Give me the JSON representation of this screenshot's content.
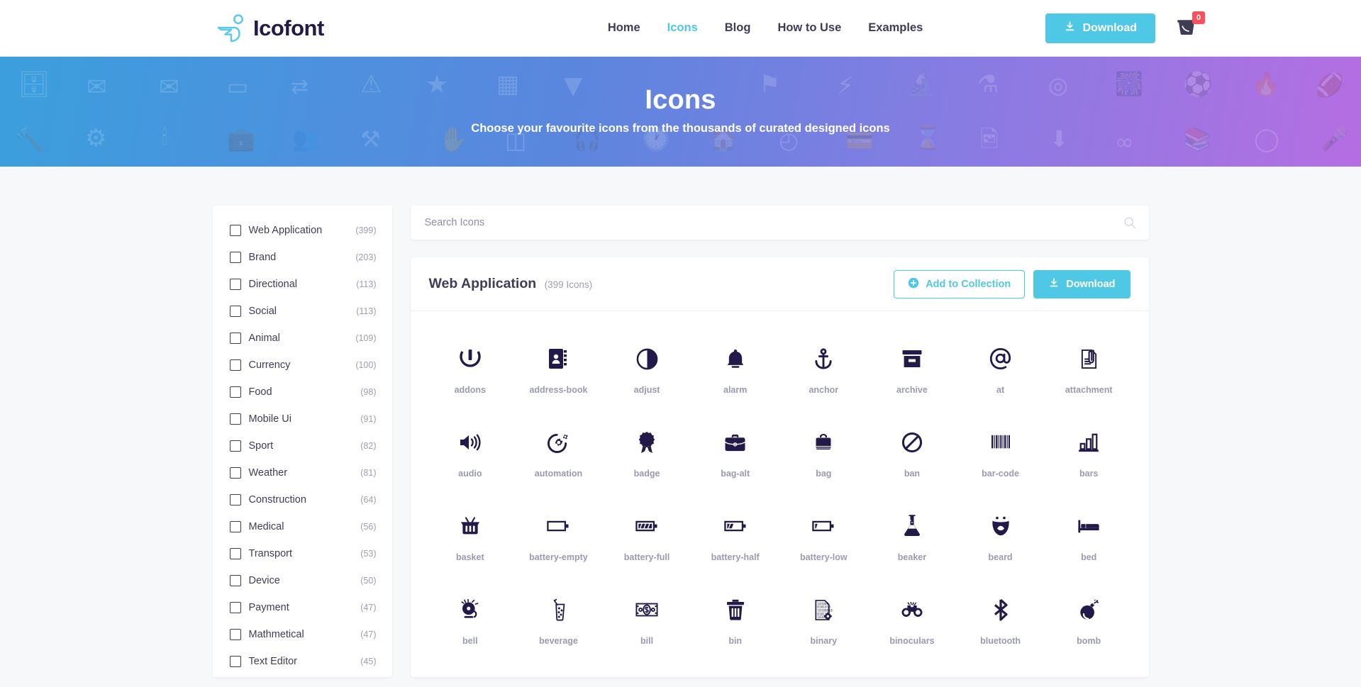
{
  "header": {
    "brand": "Icofont",
    "brand_logo_icon": "bird-leaf-logo-icon",
    "nav": [
      {
        "label": "Home",
        "active": false
      },
      {
        "label": "Icons",
        "active": true
      },
      {
        "label": "Blog",
        "active": false
      },
      {
        "label": "How to Use",
        "active": false
      },
      {
        "label": "Examples",
        "active": false
      }
    ],
    "download_label": "Download",
    "download_icon": "download-icon",
    "cart_icon": "cart-bucket-icon",
    "cart_count": "0",
    "accent_color": "#4ec8e4",
    "badge_color": "#fc4f5e",
    "text_color": "#3f3d56"
  },
  "hero": {
    "title": "Icons",
    "subtitle": "Choose your favourite icons from the thousands of curated designed icons",
    "gradient_from": "#3b9fdd",
    "gradient_to": "#b56ee2"
  },
  "sidebar": {
    "categories": [
      {
        "label": "Web Application",
        "count": "(399)"
      },
      {
        "label": "Brand",
        "count": "(203)"
      },
      {
        "label": "Directional",
        "count": "(113)"
      },
      {
        "label": "Social",
        "count": "(113)"
      },
      {
        "label": "Animal",
        "count": "(109)"
      },
      {
        "label": "Currency",
        "count": "(100)"
      },
      {
        "label": "Food",
        "count": "(98)"
      },
      {
        "label": "Mobile Ui",
        "count": "(91)"
      },
      {
        "label": "Sport",
        "count": "(82)"
      },
      {
        "label": "Weather",
        "count": "(81)"
      },
      {
        "label": "Construction",
        "count": "(64)"
      },
      {
        "label": "Medical",
        "count": "(56)"
      },
      {
        "label": "Transport",
        "count": "(53)"
      },
      {
        "label": "Device",
        "count": "(50)"
      },
      {
        "label": "Payment",
        "count": "(47)"
      },
      {
        "label": "Mathmetical",
        "count": "(47)"
      },
      {
        "label": "Text Editor",
        "count": "(45)"
      }
    ]
  },
  "search": {
    "placeholder": "Search Icons",
    "value": "",
    "icon": "search-icon"
  },
  "panel": {
    "title": "Web Application",
    "count": "(399 Icons)",
    "add_to_collection_label": "Add to Collection",
    "add_to_collection_icon": "plus-circle-icon",
    "download_label": "Download",
    "download_icon": "download-icon"
  },
  "icons": [
    {
      "name": "addons",
      "glyph": "addons-icon"
    },
    {
      "name": "address-book",
      "glyph": "address-book-icon"
    },
    {
      "name": "adjust",
      "glyph": "adjust-icon"
    },
    {
      "name": "alarm",
      "glyph": "alarm-icon"
    },
    {
      "name": "anchor",
      "glyph": "anchor-icon"
    },
    {
      "name": "archive",
      "glyph": "archive-icon"
    },
    {
      "name": "at",
      "glyph": "at-icon"
    },
    {
      "name": "attachment",
      "glyph": "attachment-icon"
    },
    {
      "name": "audio",
      "glyph": "audio-icon"
    },
    {
      "name": "automation",
      "glyph": "automation-icon"
    },
    {
      "name": "badge",
      "glyph": "badge-icon"
    },
    {
      "name": "bag-alt",
      "glyph": "bag-alt-icon"
    },
    {
      "name": "bag",
      "glyph": "bag-icon"
    },
    {
      "name": "ban",
      "glyph": "ban-icon"
    },
    {
      "name": "bar-code",
      "glyph": "bar-code-icon"
    },
    {
      "name": "bars",
      "glyph": "bars-icon"
    },
    {
      "name": "basket",
      "glyph": "basket-icon"
    },
    {
      "name": "battery-empty",
      "glyph": "battery-empty-icon"
    },
    {
      "name": "battery-full",
      "glyph": "battery-full-icon"
    },
    {
      "name": "battery-half",
      "glyph": "battery-half-icon"
    },
    {
      "name": "battery-low",
      "glyph": "battery-low-icon"
    },
    {
      "name": "beaker",
      "glyph": "beaker-icon"
    },
    {
      "name": "beard",
      "glyph": "beard-icon"
    },
    {
      "name": "bed",
      "glyph": "bed-icon"
    },
    {
      "name": "bell",
      "glyph": "bell-icon"
    },
    {
      "name": "beverage",
      "glyph": "beverage-icon"
    },
    {
      "name": "bill",
      "glyph": "bill-icon"
    },
    {
      "name": "bin",
      "glyph": "bin-icon"
    },
    {
      "name": "binary",
      "glyph": "binary-icon"
    },
    {
      "name": "binoculars",
      "glyph": "binoculars-icon"
    },
    {
      "name": "bluetooth",
      "glyph": "bluetooth-icon"
    },
    {
      "name": "bomb",
      "glyph": "bomb-icon"
    }
  ],
  "hero_background_icons": [
    "archive",
    "mail",
    "envelope",
    "eraser",
    "exchange",
    "exclamation",
    "star",
    "film",
    "filter",
    "flag",
    "flash",
    "flask-tube",
    "flask",
    "location",
    "fireworks",
    "football",
    "fire",
    "rugby",
    "plug",
    "hammer",
    "gear",
    "bottle",
    "briefcase",
    "users",
    "hammer-alt",
    "hand",
    "server",
    "headphone",
    "history",
    "home",
    "headset",
    "card",
    "hourglass",
    "image",
    "download",
    "infinity",
    "bookshelf",
    "ring",
    "microphone"
  ]
}
